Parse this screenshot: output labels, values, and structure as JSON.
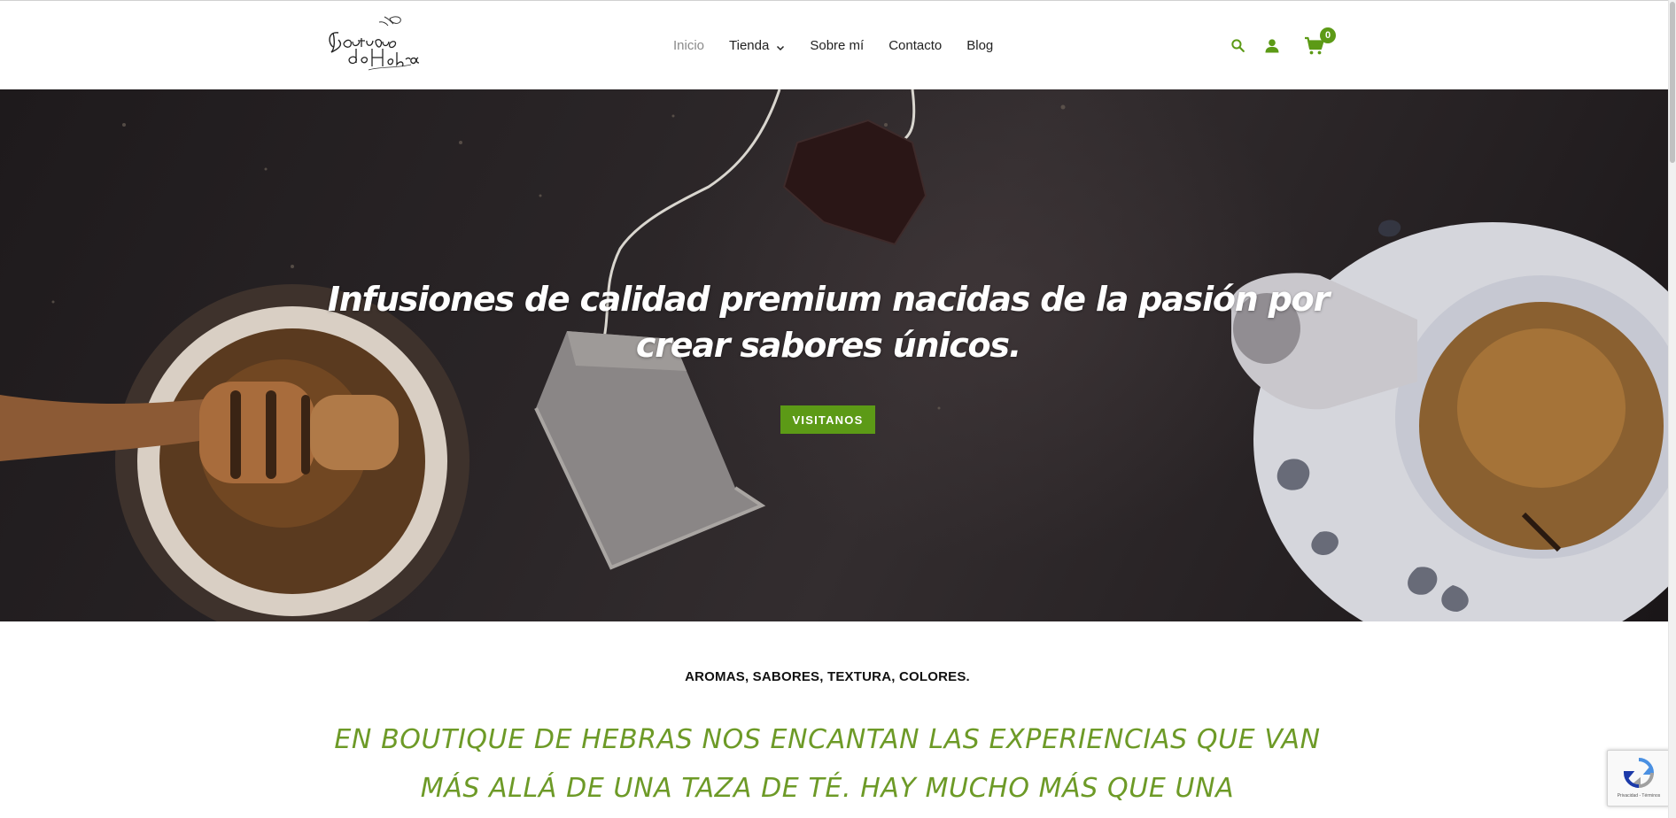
{
  "brand": {
    "logo_text": "Boutique de Hebras",
    "accent_color": "#5c9a16"
  },
  "nav": {
    "items": [
      {
        "label": "Inicio",
        "active": true
      },
      {
        "label": "Tienda",
        "has_dropdown": true
      },
      {
        "label": "Sobre mí"
      },
      {
        "label": "Contacto"
      },
      {
        "label": "Blog"
      }
    ]
  },
  "header_icons": {
    "search": "search-icon",
    "account": "user-icon",
    "cart": "cart-icon",
    "cart_count": "0"
  },
  "hero": {
    "title": "Infusiones de calidad premium nacidas de la pasión por crear sabores únicos.",
    "button_label": "VISITANOS"
  },
  "section": {
    "tagline": "AROMAS, SABORES, TEXTURA, COLORES.",
    "intro": "EN BOUTIQUE DE HEBRAS NOS ENCANTAN LAS EXPERIENCIAS QUE VAN MÁS ALLÁ DE UNA TAZA DE TÉ.  HAY MUCHO MÁS QUE UNA"
  },
  "recaptcha": {
    "footer": "Privacidad - Términos"
  }
}
